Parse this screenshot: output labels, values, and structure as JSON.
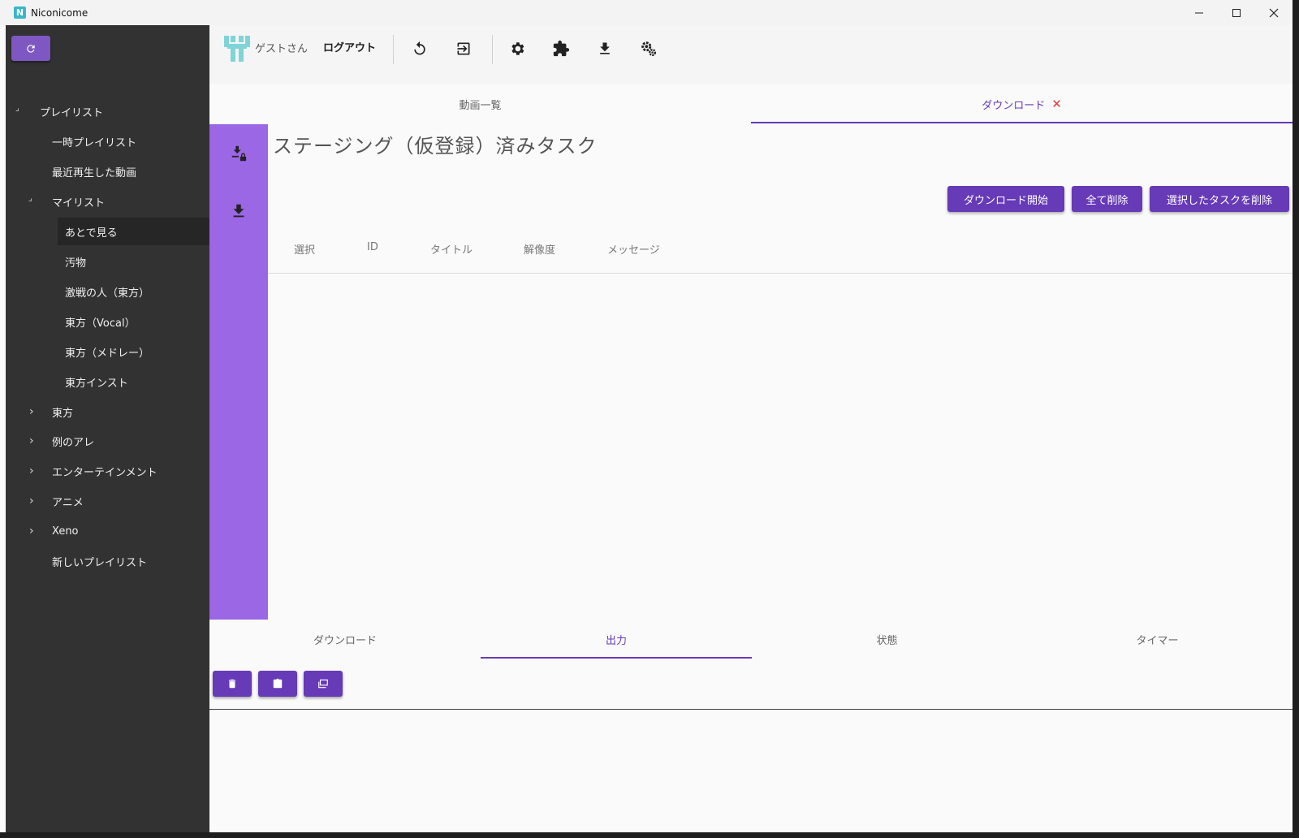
{
  "window": {
    "title": "Niconicome",
    "app_icon_letter": "N"
  },
  "sidebar": {
    "items": [
      {
        "label": "プレイリスト",
        "arrow": "⌟"
      },
      {
        "label": "一時プレイリスト",
        "arrow": ""
      },
      {
        "label": "最近再生した動画",
        "arrow": ""
      },
      {
        "label": "マイリスト",
        "arrow": "⌟"
      },
      {
        "label": "あとで見る",
        "arrow": ""
      },
      {
        "label": "汚物",
        "arrow": ""
      },
      {
        "label": "激戦の人（東方）",
        "arrow": ""
      },
      {
        "label": "東方（Vocal）",
        "arrow": ""
      },
      {
        "label": "東方（メドレー）",
        "arrow": ""
      },
      {
        "label": "東方インスト",
        "arrow": ""
      },
      {
        "label": "東方",
        "arrow": "›"
      },
      {
        "label": "例のアレ",
        "arrow": "›"
      },
      {
        "label": "エンターテインメント",
        "arrow": "›"
      },
      {
        "label": "アニメ",
        "arrow": "›"
      },
      {
        "label": "Xeno",
        "arrow": "›"
      },
      {
        "label": "新しいプレイリスト",
        "arrow": ""
      }
    ]
  },
  "toolbar": {
    "guest_label": "ゲストさん",
    "logout_label": "ログアウト"
  },
  "tabs": {
    "video_list": "動画一覧",
    "download": "ダウンロード",
    "close_symbol": "✕"
  },
  "main": {
    "heading": "ステージング（仮登録）済みタスク",
    "buttons": {
      "start_download": "ダウンロード開始",
      "delete_all": "全て削除",
      "delete_selected": "選択したタスクを削除"
    },
    "columns": [
      "選択",
      "ID",
      "タイトル",
      "解像度",
      "メッセージ"
    ]
  },
  "bottom_tabs": [
    "ダウンロード",
    "出力",
    "状態",
    "タイマー"
  ],
  "colors": {
    "accent": "#673ab7",
    "strip": "#9b67e5",
    "sidebar_bg": "#323232",
    "close": "#e53935"
  },
  "icons": [
    "refresh-icon",
    "undo-icon",
    "login-icon",
    "settings-icon",
    "extension-icon",
    "download-icon",
    "settings-multiple-icon",
    "download-lock-icon",
    "trash-icon",
    "clipboard-icon",
    "window-icon"
  ]
}
